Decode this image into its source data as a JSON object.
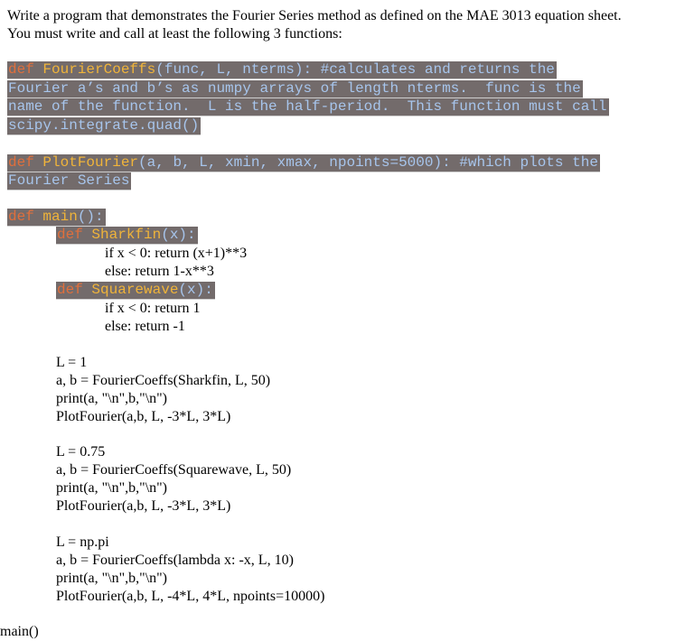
{
  "intro": {
    "line1": "Write a program that demonstrates the Fourier Series method as defined on the MAE 3013 equation sheet.",
    "line2": "You must write and call at least the following 3 functions:"
  },
  "fourier_coeffs_block": {
    "keyword": "def ",
    "name": "FourierCoeffs",
    "signature": "(func, L, nterms): #calculates and returns the",
    "line2": "Fourier a’s and b’s as numpy arrays of length nterms.  func is the",
    "line3": "name of the function.  L is the half-period.  This function must call",
    "line4": "scipy.integrate.quad()"
  },
  "plot_fourier_block": {
    "keyword": "def ",
    "name": "PlotFourier",
    "signature": "(a, b, L, xmin, xmax, npoints=5000): #which plots the",
    "line2": "Fourier Series"
  },
  "main_block": {
    "keyword": "def ",
    "name": "main",
    "signature": "():",
    "sharkfin": {
      "keyword": "def ",
      "name": "Sharkfin",
      "signature": "(x):",
      "body": [
        "if x < 0: return (x+1)**3",
        "else: return 1-x**3"
      ]
    },
    "squarewave": {
      "keyword": "def ",
      "name": "Squarewave",
      "signature": "(x):",
      "body": [
        "if x < 0: return 1",
        "else: return -1"
      ]
    },
    "case1": [
      "L = 1",
      "a, b = FourierCoeffs(Sharkfin, L, 50)",
      "print(a, \"\\n\",b,\"\\n\")",
      "PlotFourier(a,b, L, -3*L, 3*L)"
    ],
    "case2": [
      "L = 0.75",
      "a, b = FourierCoeffs(Squarewave, L, 50)",
      "print(a, \"\\n\",b,\"\\n\")",
      "PlotFourier(a,b, L, -3*L, 3*L)"
    ],
    "case3": [
      "L = np.pi",
      "a, b = FourierCoeffs(lambda x: -x, L, 10)",
      "print(a, \"\\n\",b,\"\\n\")",
      "PlotFourier(a,b, L, -4*L, 4*L, npoints=10000)"
    ]
  },
  "call": "main()"
}
